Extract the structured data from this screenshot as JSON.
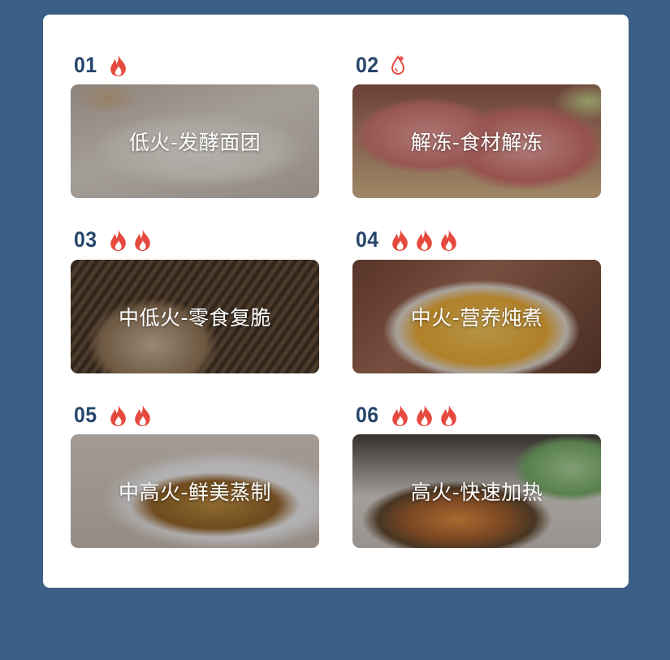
{
  "modes": [
    {
      "number": "01",
      "icon": "flame-icon",
      "flames": 1,
      "label": "低火-发酵面团",
      "bg": "dough"
    },
    {
      "number": "02",
      "icon": "thaw-drop-icon",
      "flames": 0,
      "label": "解冻-食材解冻",
      "bg": "meat"
    },
    {
      "number": "03",
      "icon": "flame-icon",
      "flames": 2,
      "label": "中低火-零食复脆",
      "bg": "nuts"
    },
    {
      "number": "04",
      "icon": "flame-icon",
      "flames": 3,
      "label": "中火-营养炖煮",
      "bg": "stew"
    },
    {
      "number": "05",
      "icon": "flame-icon",
      "flames": 2,
      "label": "中高火-鲜美蒸制",
      "bg": "fish"
    },
    {
      "number": "06",
      "icon": "flame-icon",
      "flames": 3,
      "label": "高火-快速加热",
      "bg": "stirfry"
    }
  ],
  "colors": {
    "background": "#3a6087",
    "card": "#ffffff",
    "number": "#27456b",
    "flame": "#e64a3e",
    "label": "#ffffff"
  }
}
